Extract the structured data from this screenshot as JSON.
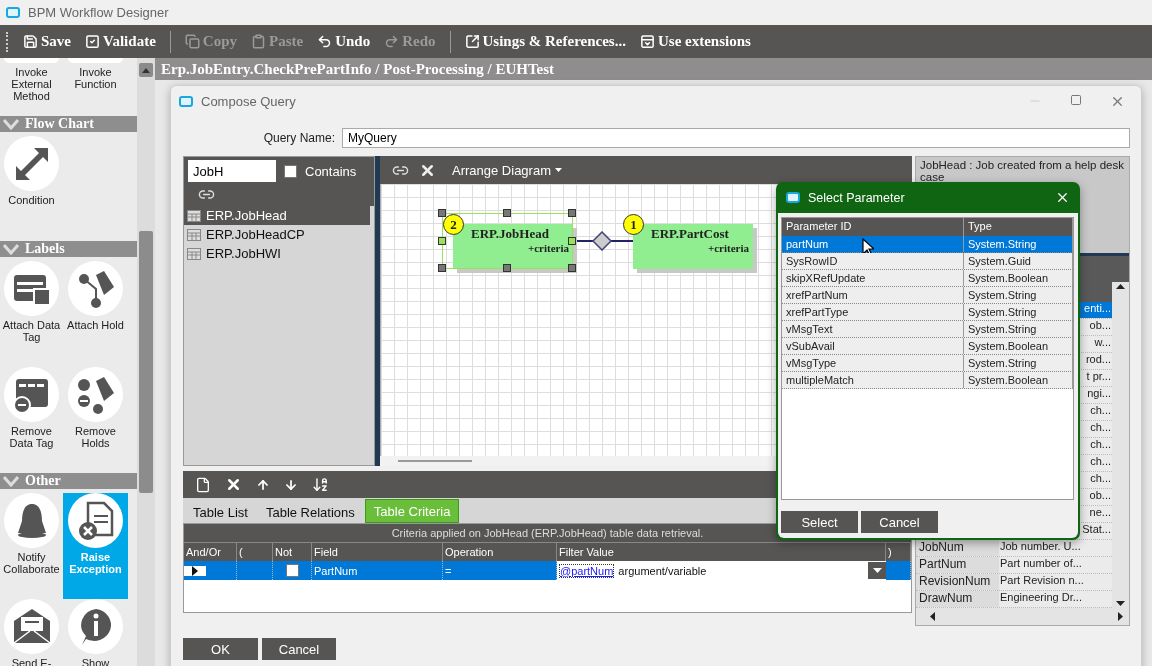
{
  "window": {
    "title": "BPM Workflow Designer"
  },
  "toolbar": [
    {
      "kind": "save",
      "label": "Save",
      "disabled": false
    },
    {
      "kind": "validate",
      "label": "Validate",
      "disabled": false
    },
    {
      "kind": "separator"
    },
    {
      "kind": "copy",
      "label": "Copy",
      "disabled": true
    },
    {
      "kind": "paste",
      "label": "Paste",
      "disabled": true
    },
    {
      "kind": "undo",
      "label": "Undo",
      "disabled": false
    },
    {
      "kind": "redo",
      "label": "Redo",
      "disabled": true
    },
    {
      "kind": "separator"
    },
    {
      "kind": "usings",
      "label": "Usings & References...",
      "disabled": false
    },
    {
      "kind": "extensions",
      "label": "Use extensions",
      "disabled": false
    }
  ],
  "sidebar": {
    "sections": [
      {
        "items": [
          {
            "kind": "cut",
            "label": "Invoke External Method",
            "selected": false
          },
          {
            "kind": "cut",
            "label": "Invoke Function",
            "selected": false
          }
        ]
      },
      {
        "title": "Flow Chart",
        "items": [
          {
            "kind": "condition",
            "label": "Condition",
            "selected": false
          }
        ]
      },
      {
        "title": "Labels",
        "items": [
          {
            "kind": "attach-tag",
            "label": "Attach Data Tag",
            "selected": false
          },
          {
            "kind": "attach-hold",
            "label": "Attach Hold",
            "selected": false
          },
          {
            "kind": "remove-tag",
            "label": "Remove Data Tag",
            "selected": false
          },
          {
            "kind": "remove-hold",
            "label": "Remove Holds",
            "selected": false
          }
        ]
      },
      {
        "title": "Other",
        "items": [
          {
            "kind": "notify",
            "label": "Notify Collaborate",
            "selected": false
          },
          {
            "kind": "raise",
            "label": "Raise Exception",
            "selected": true
          },
          {
            "kind": "email",
            "label": "Send E-",
            "selected": false
          },
          {
            "kind": "show",
            "label": "Show",
            "selected": false
          }
        ]
      }
    ]
  },
  "breadcrumb": "Erp.JobEntry.CheckPrePartInfo / Post-Processing / EUHTest",
  "compose_query": {
    "title": "Compose Query",
    "query_name_label": "Query Name:",
    "query_name": "MyQuery",
    "table_search": {
      "value": "JobH",
      "contains_label": "Contains",
      "contains_checked": false
    },
    "tables": [
      {
        "name": "ERP.JobHead",
        "selected": true
      },
      {
        "name": "ERP.JobHeadCP",
        "selected": false
      },
      {
        "name": "ERP.JobHWI",
        "selected": false
      }
    ],
    "diagram": {
      "arrange_label": "Arrange Diagram",
      "nodes": [
        {
          "name": "ERP.JobHead",
          "order": "2",
          "note": "+criteria",
          "selected": true
        },
        {
          "name": "ERP.PartCost",
          "order": "1",
          "note": "+criteria",
          "selected": false
        }
      ]
    },
    "description": "JobHead : Job created from a help desk case",
    "fields": [
      {
        "description": "enti...",
        "selected": true
      },
      {
        "description": "ob...",
        "selected": false
      },
      {
        "description": "w...",
        "selected": false
      },
      {
        "description": "rod...",
        "selected": false
      },
      {
        "description": "t pr...",
        "selected": false
      },
      {
        "description": "ngi...",
        "selected": false
      },
      {
        "description": "ch...",
        "selected": false
      },
      {
        "description": "ch...",
        "selected": false
      },
      {
        "description": "ch...",
        "selected": false
      },
      {
        "description": "ch...",
        "selected": false
      },
      {
        "description": "ch...",
        "selected": false
      },
      {
        "description": "ob...",
        "selected": false
      },
      {
        "description": "ne...",
        "selected": false
      },
      {
        "description": "Stat...",
        "selected": false
      },
      {
        "name": "JobNum",
        "description": "Job number.  U...",
        "selected": false
      },
      {
        "name": "PartNum",
        "description": "Part number of...",
        "selected": false
      },
      {
        "name": "RevisionNum",
        "description": "Part Revision n...",
        "selected": false
      },
      {
        "name": "DrawNum",
        "description": "Engineering Dr...",
        "selected": false
      }
    ],
    "tabs": [
      {
        "label": "Table List",
        "selected": false
      },
      {
        "label": "Table Relations",
        "selected": false
      },
      {
        "label": "Table Criteria",
        "selected": true
      }
    ],
    "criteria": {
      "caption": "Criteria applied on JobHead (ERP.JobHead)  table data retrieval.",
      "columns": [
        "And/Or",
        "(",
        "Not",
        "Field",
        "Operation",
        "Filter Value",
        ")"
      ],
      "rows": [
        {
          "not": false,
          "field": "PartNum",
          "operation": "=",
          "filter_link": "@partNum",
          "filter_text": "argument/variable",
          "selected": true
        }
      ]
    },
    "buttons": [
      "OK",
      "Cancel"
    ]
  },
  "select_parameter": {
    "title": "Select Parameter",
    "columns": [
      "Parameter ID",
      "Type"
    ],
    "rows": [
      {
        "id": "partNum",
        "type": "System.String",
        "selected": true
      },
      {
        "id": "SysRowID",
        "type": "System.Guid",
        "selected": false
      },
      {
        "id": "skipXRefUpdate",
        "type": "System.Boolean",
        "selected": false
      },
      {
        "id": "xrefPartNum",
        "type": "System.String",
        "selected": false
      },
      {
        "id": "xrefPartType",
        "type": "System.String",
        "selected": false
      },
      {
        "id": "vMsgText",
        "type": "System.String",
        "selected": false
      },
      {
        "id": "vSubAvail",
        "type": "System.Boolean",
        "selected": false
      },
      {
        "id": "vMsgType",
        "type": "System.String",
        "selected": false
      },
      {
        "id": "multipleMatch",
        "type": "System.Boolean",
        "selected": false
      }
    ],
    "buttons": [
      "Select",
      "Cancel"
    ]
  }
}
